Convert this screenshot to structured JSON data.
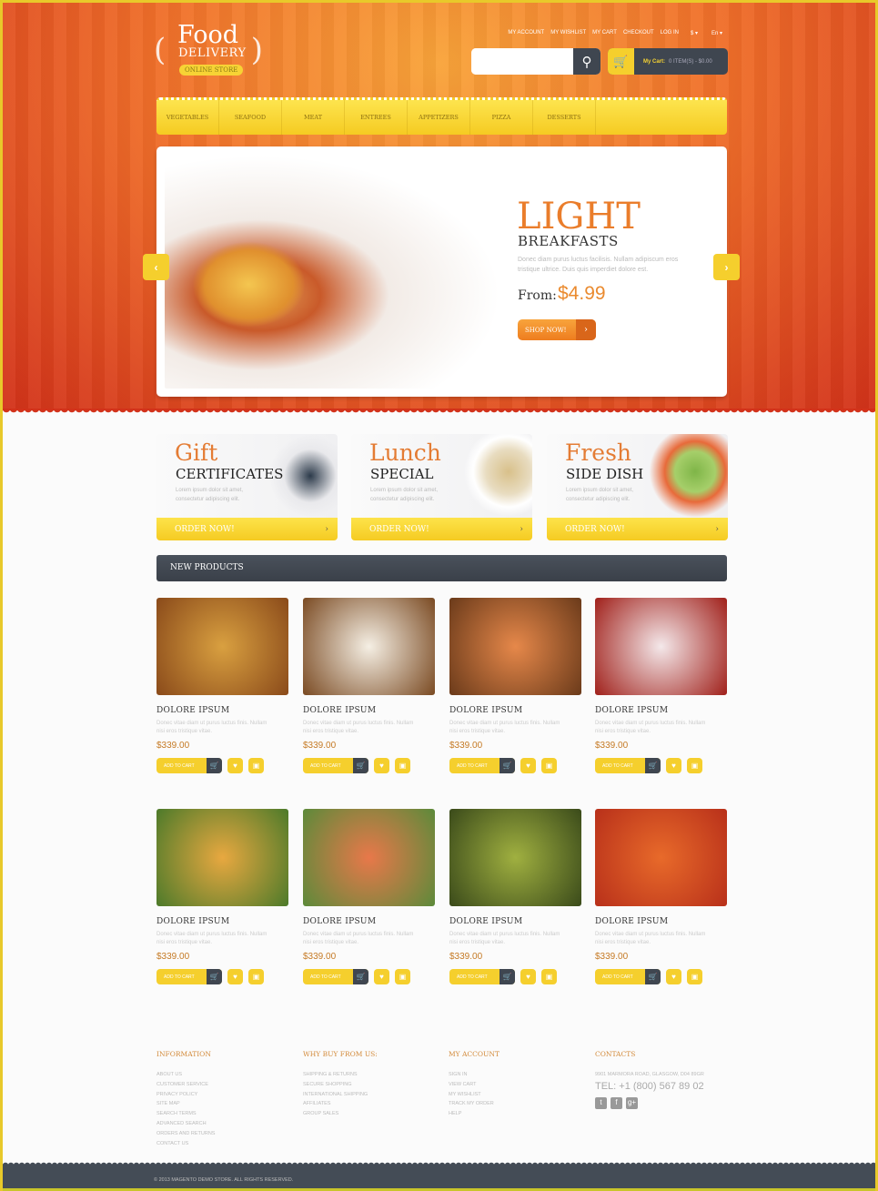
{
  "brand": {
    "line1": "Food",
    "line2": "DELIVERY",
    "badge": "ONLINE STORE"
  },
  "toplinks": [
    "MY ACCOUNT",
    "MY WISHLIST",
    "MY CART",
    "CHECKOUT",
    "LOG IN",
    "$ ▾",
    "En ▾"
  ],
  "search": {
    "placeholder": "",
    "icon": "search-icon"
  },
  "cart": {
    "label": "My Cart:",
    "value": "0 ITEM(S) - $0.00"
  },
  "nav": [
    "VEGETABLES",
    "SEAFOOD",
    "MEAT",
    "ENTREES",
    "APPETIZERS",
    "PIZZA",
    "DESSERTS"
  ],
  "slider": {
    "title": "LIGHT",
    "subtitle": "BREAKFASTS",
    "desc": "Donec diam purus luctus facilisis. Nullam adipiscum eros tristique ultrice. Duis quis imperdiet dolore est.",
    "from": "From:",
    "price": "$4.99",
    "button": "SHOP NOW!"
  },
  "promos": [
    {
      "title": "Gift",
      "subtitle": "CERTIFICATES",
      "desc": "Lorem ipsum dolor sit amet, consectetur adipiscing elit.",
      "button": "ORDER NOW!"
    },
    {
      "title": "Lunch",
      "subtitle": "SPECIAL",
      "desc": "Lorem ipsum dolor sit amet, consectetur adipiscing elit.",
      "button": "ORDER NOW!"
    },
    {
      "title": "Fresh",
      "subtitle": "SIDE DISH",
      "desc": "Lorem ipsum dolor sit amet, consectetur adipiscing elit.",
      "button": "ORDER NOW!"
    }
  ],
  "new_products": {
    "title": "NEW PRODUCTS",
    "add_label": "ADD TO CART",
    "items": [
      {
        "name": "DOLORE IPSUM",
        "desc": "Donec vitae diam ut purus luctus finis. Nullam nisi eros tristique vitae.",
        "price": "$339.00"
      },
      {
        "name": "DOLORE IPSUM",
        "desc": "Donec vitae diam ut purus luctus finis. Nullam nisi eros tristique vitae.",
        "price": "$339.00"
      },
      {
        "name": "DOLORE IPSUM",
        "desc": "Donec vitae diam ut purus luctus finis. Nullam nisi eros tristique vitae.",
        "price": "$339.00"
      },
      {
        "name": "DOLORE IPSUM",
        "desc": "Donec vitae diam ut purus luctus finis. Nullam nisi eros tristique vitae.",
        "price": "$339.00"
      },
      {
        "name": "DOLORE IPSUM",
        "desc": "Donec vitae diam ut purus luctus finis. Nullam nisi eros tristique vitae.",
        "price": "$339.00"
      },
      {
        "name": "DOLORE IPSUM",
        "desc": "Donec vitae diam ut purus luctus finis. Nullam nisi eros tristique vitae.",
        "price": "$339.00"
      },
      {
        "name": "DOLORE IPSUM",
        "desc": "Donec vitae diam ut purus luctus finis. Nullam nisi eros tristique vitae.",
        "price": "$339.00"
      },
      {
        "name": "DOLORE IPSUM",
        "desc": "Donec vitae diam ut purus luctus finis. Nullam nisi eros tristique vitae.",
        "price": "$339.00"
      }
    ]
  },
  "footer": {
    "information": {
      "title": "INFORMATION",
      "links": [
        "ABOUT US",
        "CUSTOMER SERVICE",
        "PRIVACY POLICY",
        "SITE MAP",
        "SEARCH TERMS",
        "ADVANCED SEARCH",
        "ORDERS AND RETURNS",
        "CONTACT US"
      ]
    },
    "why": {
      "title": "WHY BUY FROM US:",
      "links": [
        "SHIPPING & RETURNS",
        "SECURE SHOPPING",
        "INTERNATIONAL SHIPPING",
        "AFFILIATES",
        "GROUP SALES"
      ]
    },
    "account": {
      "title": "MY ACCOUNT",
      "links": [
        "SIGN IN",
        "VIEW CART",
        "MY WISHLIST",
        "TRACK MY ORDER",
        "HELP"
      ]
    },
    "contacts": {
      "title": "CONTACTS",
      "address": "9901 MARMORA ROAD, GLASGOW, D04 89GR",
      "tel": "TEL: +1 (800) 567 89 02",
      "social": [
        "twitter-icon",
        "facebook-icon",
        "google-plus-icon"
      ]
    },
    "copyright": "© 2013 MAGENTO DEMO STORE. ALL RIGHTS RESERVED."
  },
  "colors": {
    "accent": "#ea7d2b",
    "yellow": "#f5cf2d",
    "dark": "#3f4650"
  }
}
